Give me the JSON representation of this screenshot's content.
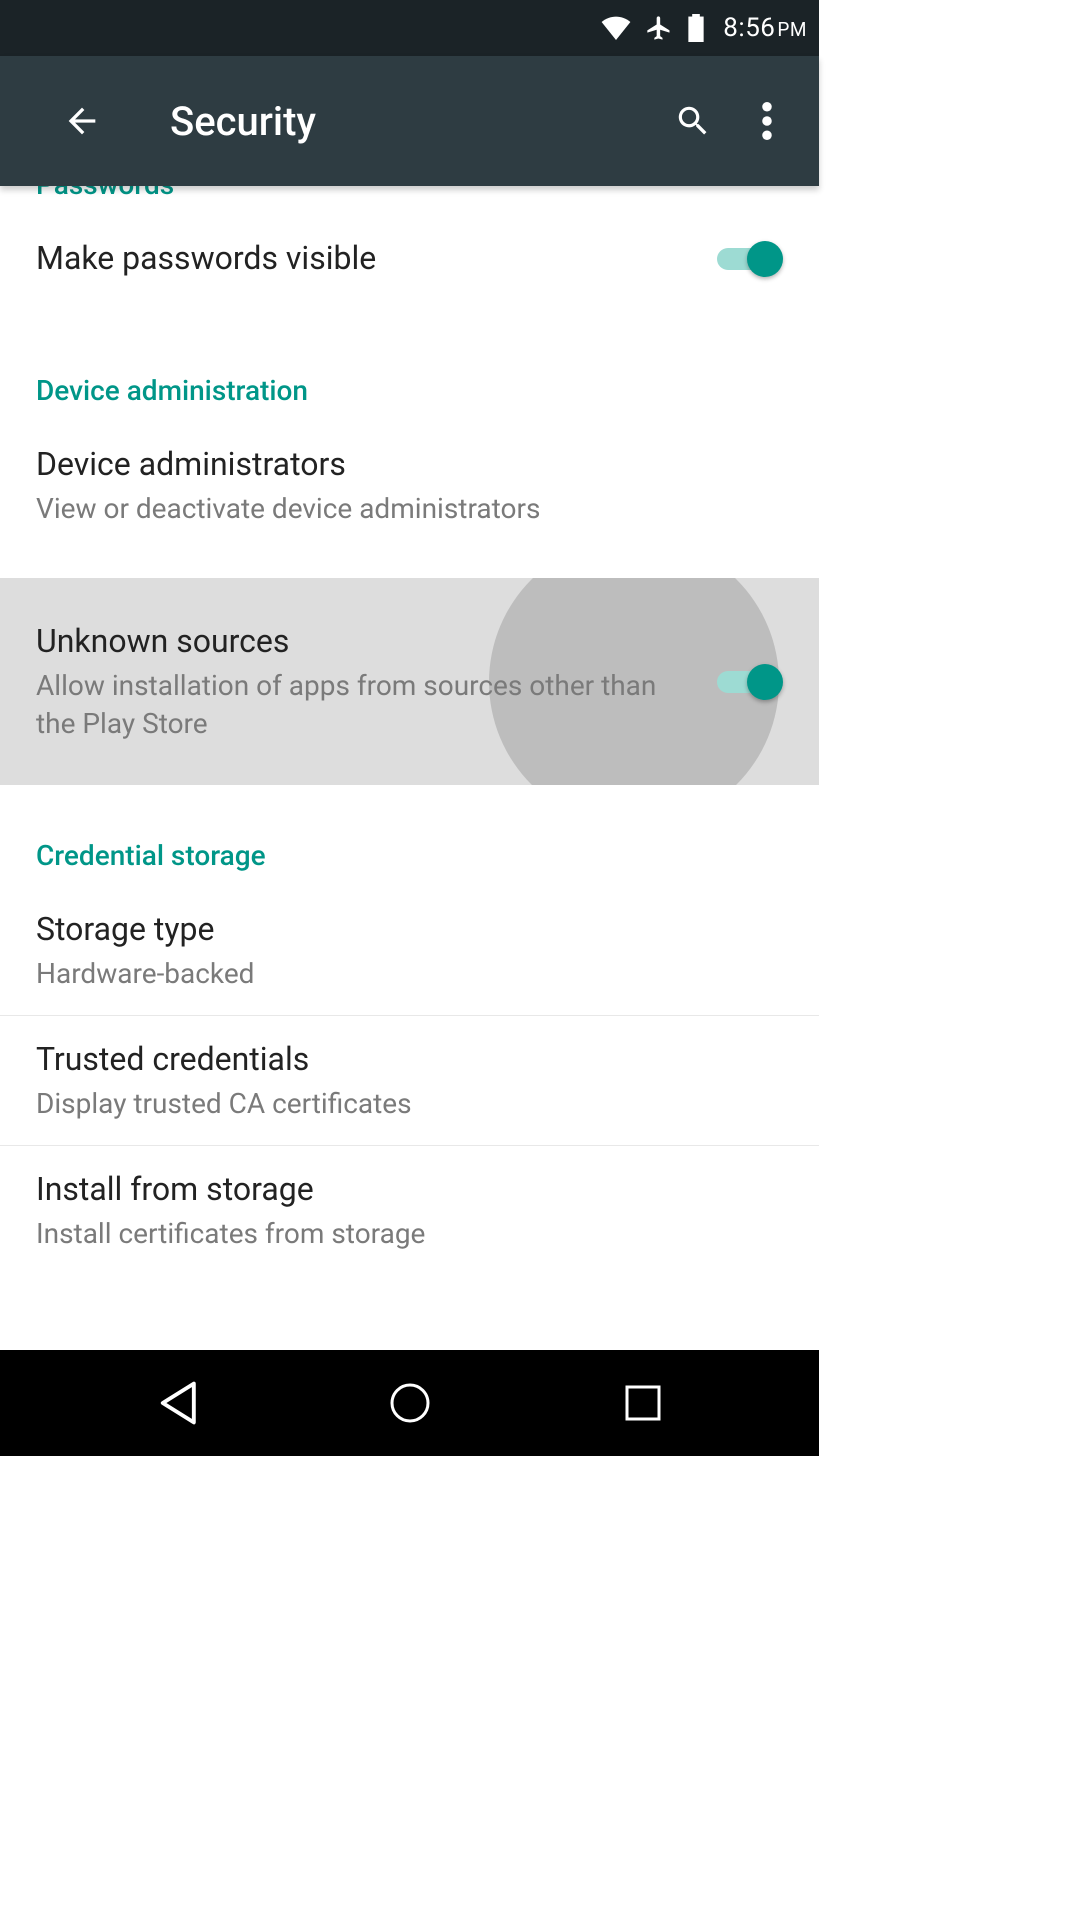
{
  "status": {
    "time": "8:56",
    "ampm": "PM"
  },
  "appbar": {
    "title": "Security"
  },
  "sections": {
    "passwords": {
      "header": "Passwords",
      "make_visible": {
        "title": "Make passwords visible",
        "on": true
      }
    },
    "device_admin": {
      "header": "Device administration",
      "administrators": {
        "title": "Device administrators",
        "sub": "View or deactivate device administrators"
      },
      "unknown_sources": {
        "title": "Unknown sources",
        "sub": "Allow installation of apps from sources other than the Play Store",
        "on": true
      }
    },
    "credential": {
      "header": "Credential storage",
      "storage_type": {
        "title": "Storage type",
        "sub": "Hardware-backed"
      },
      "trusted": {
        "title": "Trusted credentials",
        "sub": "Display trusted CA certificates"
      },
      "install": {
        "title": "Install from storage",
        "sub": "Install certificates from storage"
      }
    }
  }
}
